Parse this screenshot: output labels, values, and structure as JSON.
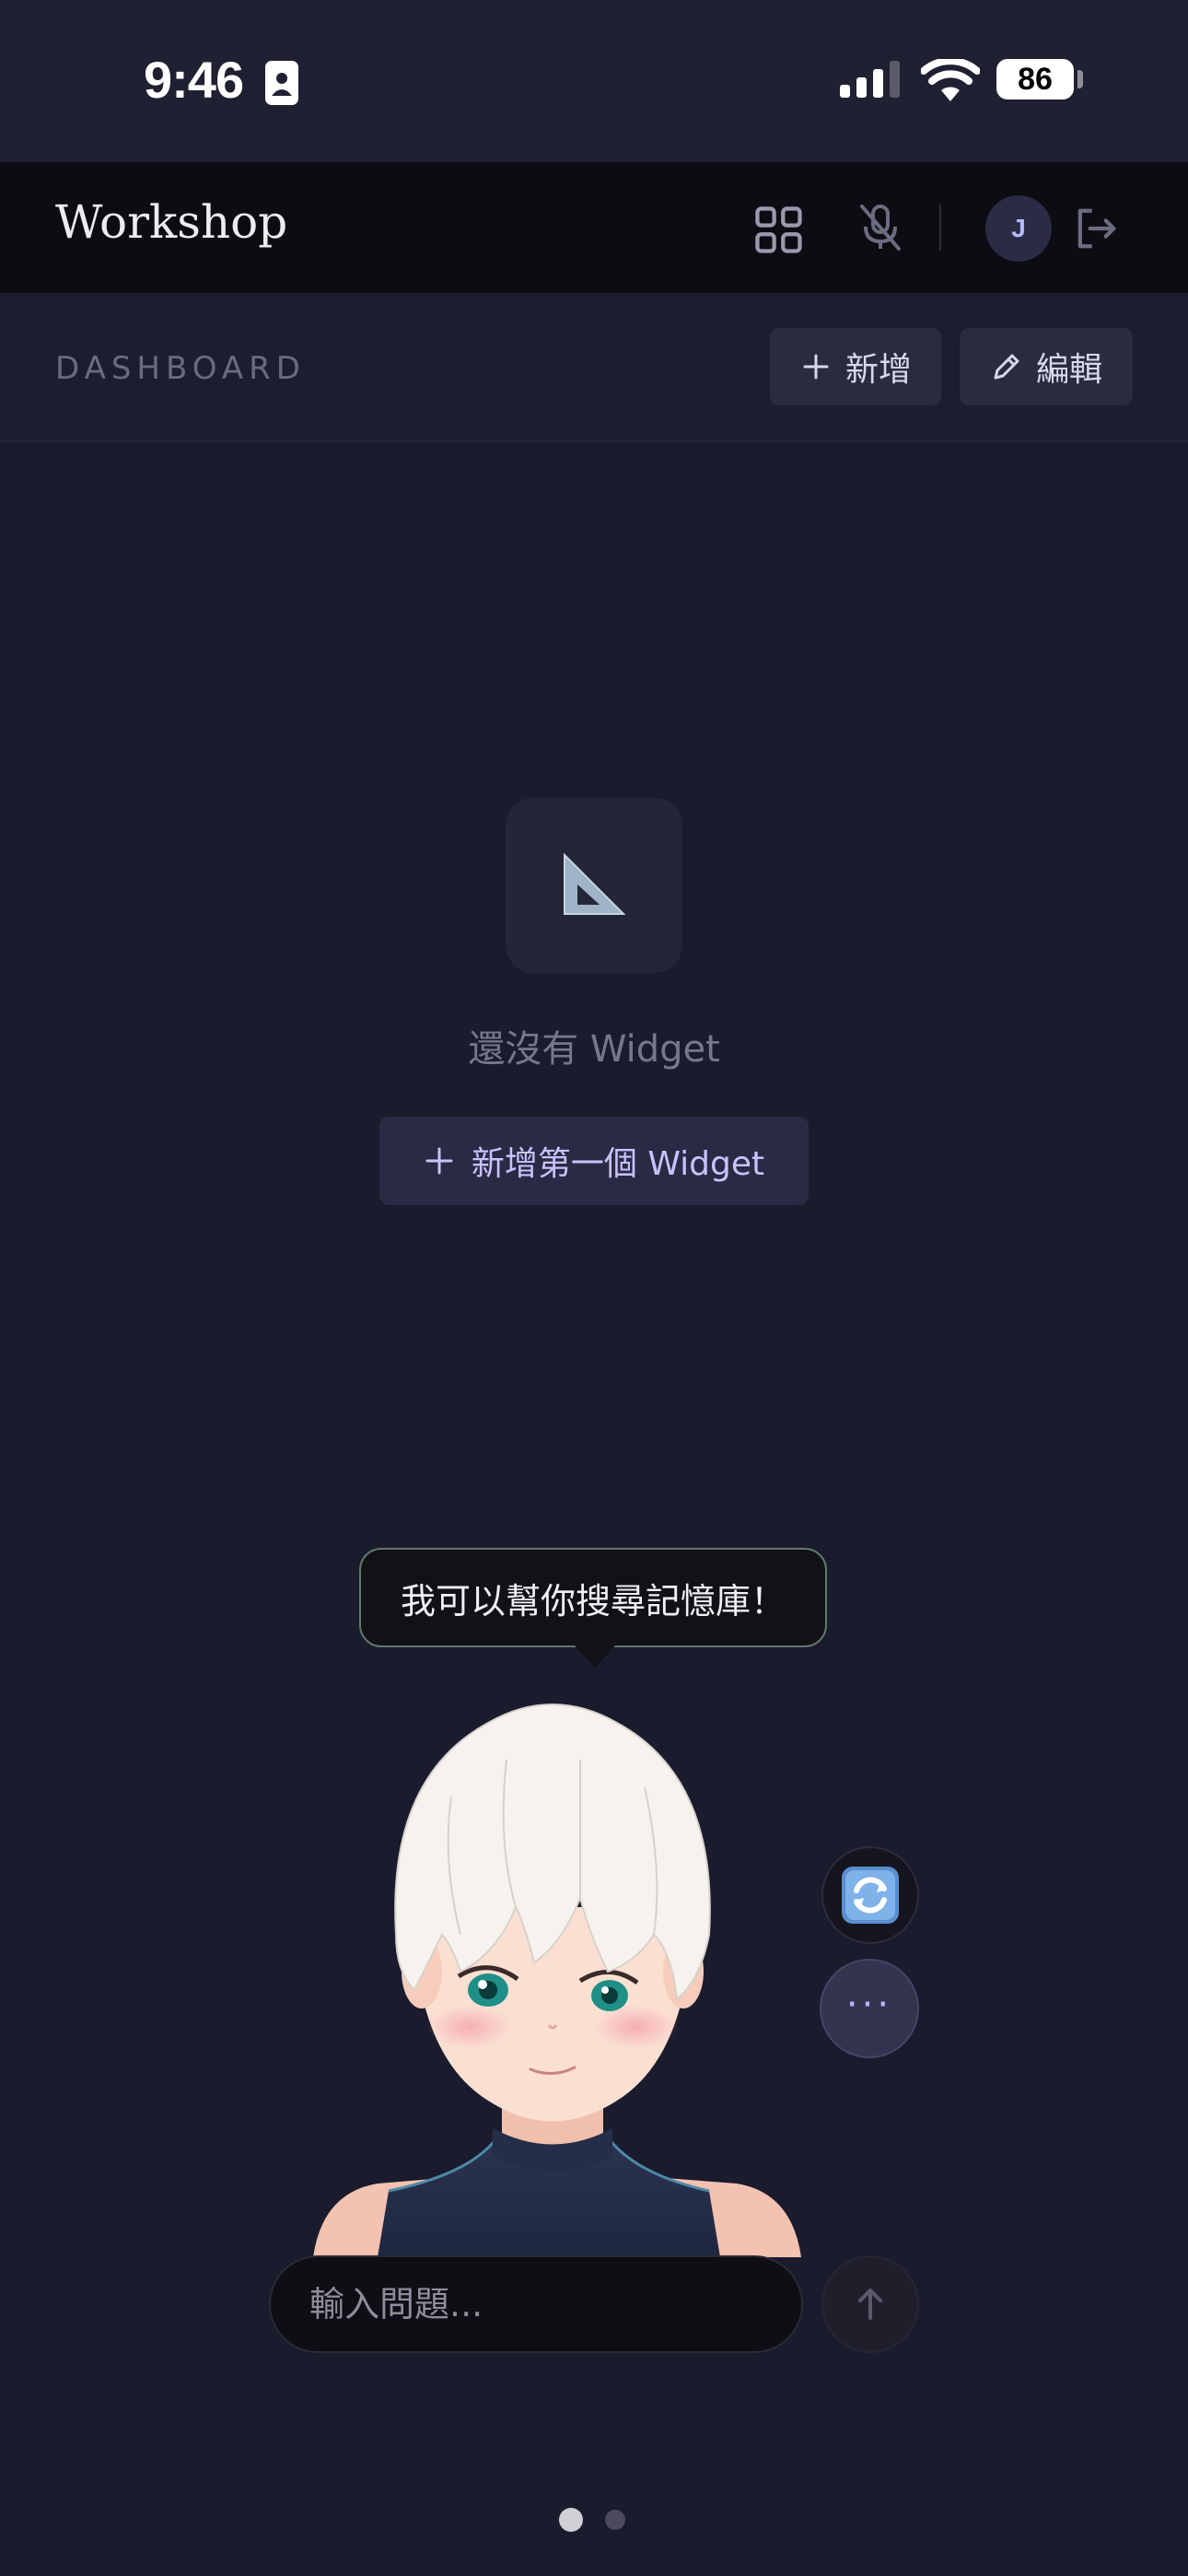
{
  "status_bar": {
    "time": "9:46",
    "battery": "86"
  },
  "header": {
    "title": "Workshop",
    "avatar_initial": "J",
    "icons": [
      "grid-icon",
      "mic-off-icon",
      "logout-icon"
    ]
  },
  "dashboard": {
    "label": "DASHBOARD",
    "add_label": "新增",
    "edit_label": "編輯"
  },
  "empty_state": {
    "icon": "triangle-ruler-icon",
    "message": "還沒有 Widget",
    "button_label": "新增第一個 Widget"
  },
  "assistant": {
    "bubble_text": "我可以幫你搜尋記憶庫！",
    "more_label": "···",
    "input_placeholder": "輸入問題..."
  },
  "pager": {
    "pages": 2,
    "active": 1
  },
  "colors": {
    "background": "#1b1b2e",
    "header": "#0c0c12",
    "accent": "#b9b8ff",
    "bubble_border": "#5f7a68"
  }
}
